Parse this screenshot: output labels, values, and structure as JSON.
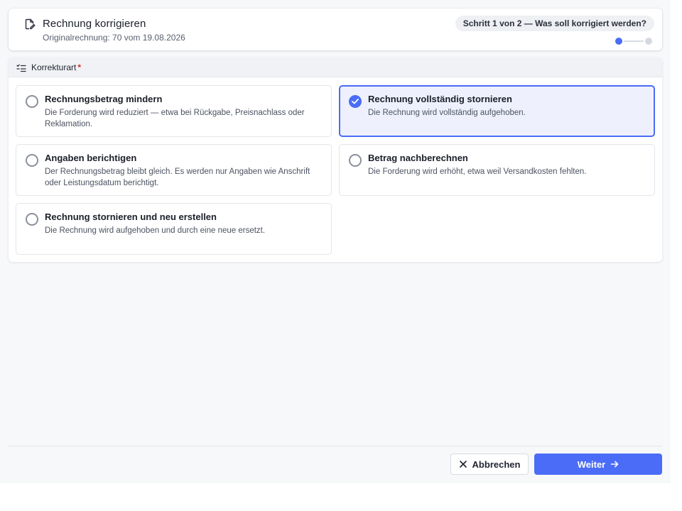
{
  "colors": {
    "accent": "#4a6cf7",
    "required": "#d62d2d",
    "selected_bg": "#eef1fd"
  },
  "header": {
    "icon": "document-edit-icon",
    "title": "Rechnung korrigieren",
    "subtitle": "Originalrechnung: 70 vom 19.08.2026",
    "step_text": "Schritt 1 von 2 — Was soll korrigiert werden?",
    "steps_total": 2,
    "steps_current": 1
  },
  "section": {
    "icon": "checklist-icon",
    "label": "Korrekturart",
    "required_mark": "*"
  },
  "options": [
    {
      "title": "Rechnungsbetrag mindern",
      "desc": "Die Forderung wird reduziert — etwa bei Rückgabe, Preisnachlass oder Reklamation.",
      "selected": false
    },
    {
      "title": "Rechnung vollständig stornieren",
      "desc": "Die Rechnung wird vollständig aufgehoben.",
      "selected": true
    },
    {
      "title": "Angaben berichtigen",
      "desc": "Der Rechnungsbetrag bleibt gleich. Es werden nur Angaben wie Anschrift oder Leistungsdatum berichtigt.",
      "selected": false
    },
    {
      "title": "Betrag nachberechnen",
      "desc": "Die Forderung wird erhöht, etwa weil Versandkosten fehlten.",
      "selected": false
    },
    {
      "title": "Rechnung stornieren und neu erstellen",
      "desc": "Die Rechnung wird aufgehoben und durch eine neue ersetzt.",
      "selected": false
    }
  ],
  "footer": {
    "cancel_label": "Abbrechen",
    "cancel_icon": "close-icon",
    "next_label": "Weiter",
    "next_icon": "arrow-right-icon"
  }
}
